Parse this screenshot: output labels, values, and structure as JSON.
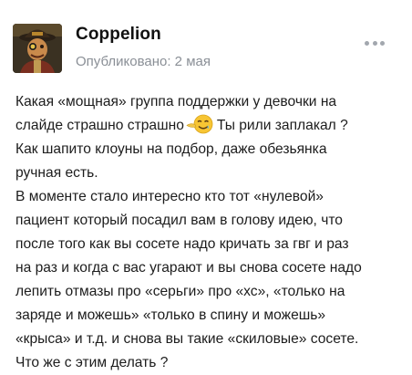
{
  "post": {
    "author": {
      "name": "Coppelion",
      "avatar_icon": "avatar-pirate-character-icon"
    },
    "meta": "Опубликовано: 2 мая",
    "menu_icon": "more-horizontal-icon",
    "body": {
      "line1": "Какая «мощная» группа поддержки у девочки на",
      "line2_before": "слайде страшно страшно",
      "line2_emoji": "smiling-face-with-tear-icon",
      "line2_after": "Ты рили заплакал ?",
      "line3": "Как шапито клоуны на подбор, даже обезьянка",
      "line4": "ручная есть.",
      "line5": "В моменте стало интересно кто тот «нулевой»",
      "line6": "пациент который посадил вам в голову идею, что",
      "line7": "после того как вы сосете надо кричать за гвг и раз",
      "line8": "на раз и когда с вас угарают и вы снова сосете надо",
      "line9": "лепить отмазы про «серьги» про «хс», «только на",
      "line10": "заряде и можешь» «только в спину и можешь»",
      "line11": "«крыса» и т.д. и снова вы такие «скиловые» сосете.",
      "line12": "Что же с этим делать ?"
    }
  },
  "colors": {
    "text": "#1c1c1c",
    "muted": "#8a8f96",
    "menu_dots": "#a2a7ae",
    "emoji_face": "#f7c533"
  }
}
